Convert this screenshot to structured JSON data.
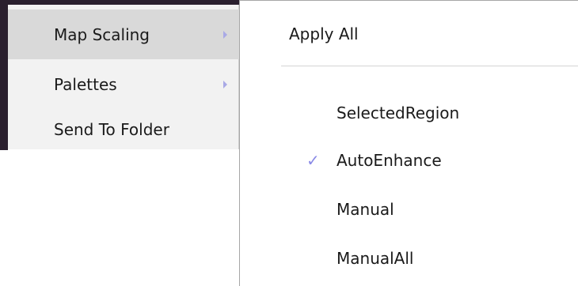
{
  "main_menu": {
    "items": [
      {
        "label": "Map Scaling",
        "has_submenu": true,
        "highlighted": true
      },
      {
        "label": "Palettes",
        "has_submenu": true,
        "highlighted": false
      },
      {
        "label": "Send To Folder",
        "has_submenu": false,
        "highlighted": false
      }
    ]
  },
  "submenu": {
    "apply_all_label": "Apply All",
    "items": [
      {
        "label": "SelectedRegion",
        "checked": false
      },
      {
        "label": "AutoEnhance",
        "checked": true
      },
      {
        "label": "Manual",
        "checked": false
      },
      {
        "label": "ManualAll",
        "checked": false
      }
    ],
    "check_glyph": "✓"
  },
  "colors": {
    "menu_bg": "#f2f2f2",
    "hover_bg": "#d9d9d9",
    "accent": "#8a8ae6",
    "backdrop": "#2a1f2e"
  }
}
